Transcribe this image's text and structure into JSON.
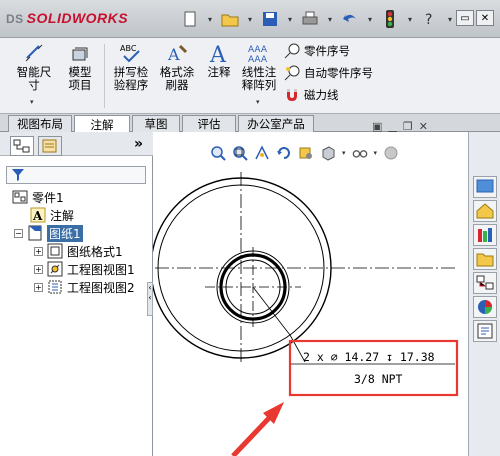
{
  "app": {
    "logo_prefix": "DS",
    "logo_text": "SOLIDWORKS"
  },
  "quick_access": [
    "new-file",
    "open-folder",
    "save",
    "print",
    "undo",
    "rebuild-traffic-light",
    "help"
  ],
  "ribbon": {
    "smart_dimension": "智能尺寸",
    "model_items": "模型项目",
    "spell_checker": "拼写检验程序",
    "format_painter": "格式涂刷器",
    "note": "注释",
    "linear_note_pattern": "线性注释阵列",
    "balloon": "零件序号",
    "auto_balloon": "自动零件序号",
    "magnetic_line": "磁力线"
  },
  "tabs": [
    "视图布局",
    "注解",
    "草图",
    "评估",
    "办公室产品"
  ],
  "active_tab": 1,
  "tree": {
    "root": "零件1",
    "annotations": "注解",
    "sheet": "图纸1",
    "sheet_format": "图纸格式1",
    "drawing_view1": "工程图视图1",
    "drawing_view2": "工程图视图2"
  },
  "callout": {
    "line1": "2 x  ∅ 14.27  ↧ 17.38",
    "line2": "3/8 NPT"
  },
  "colors": {
    "accent": "#c8102e",
    "selection": "#3a6ea5",
    "highlight_box": "#e8382f"
  }
}
